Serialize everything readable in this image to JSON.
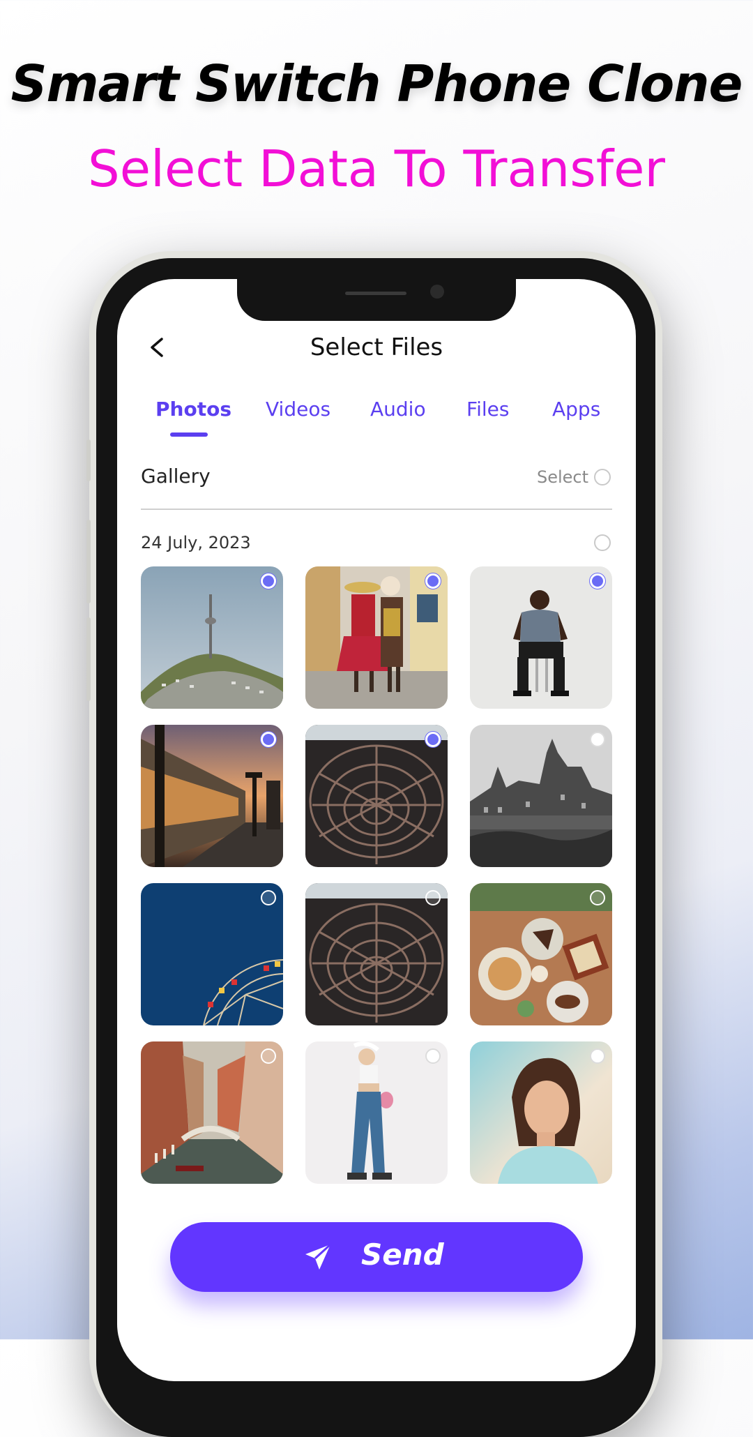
{
  "promo": {
    "headline": "Smart Switch Phone Clone",
    "subheadline": "Select Data To Transfer"
  },
  "header": {
    "back_icon": "chevron-left-icon",
    "title": "Select Files"
  },
  "tabs": [
    {
      "label": "Photos",
      "active": true
    },
    {
      "label": "Videos",
      "active": false
    },
    {
      "label": "Audio",
      "active": false
    },
    {
      "label": "Files",
      "active": false
    },
    {
      "label": "Apps",
      "active": false
    }
  ],
  "gallery": {
    "label": "Gallery",
    "select_label": "Select",
    "date": "24 July, 2023",
    "photos": [
      {
        "subject": "tower on hill",
        "selected": true
      },
      {
        "subject": "people in traditional dress",
        "selected": true
      },
      {
        "subject": "man seated on stool",
        "selected": true
      },
      {
        "subject": "train at sunset",
        "selected": true
      },
      {
        "subject": "vessel staircase structure",
        "selected": true
      },
      {
        "subject": "black and white castle",
        "selected": false
      },
      {
        "subject": "ferris wheel blue sky",
        "selected": false
      },
      {
        "subject": "vessel staircase structure",
        "selected": false
      },
      {
        "subject": "food on table",
        "selected": false
      },
      {
        "subject": "venice canal",
        "selected": false
      },
      {
        "subject": "woman in jeans",
        "selected": false
      },
      {
        "subject": "woman portrait",
        "selected": false
      }
    ]
  },
  "send_button": {
    "label": "Send",
    "icon": "paper-plane-icon"
  },
  "colors": {
    "accent": "#6236ff",
    "tab_text": "#5b3ff0",
    "subheadline": "#f20fd6"
  }
}
